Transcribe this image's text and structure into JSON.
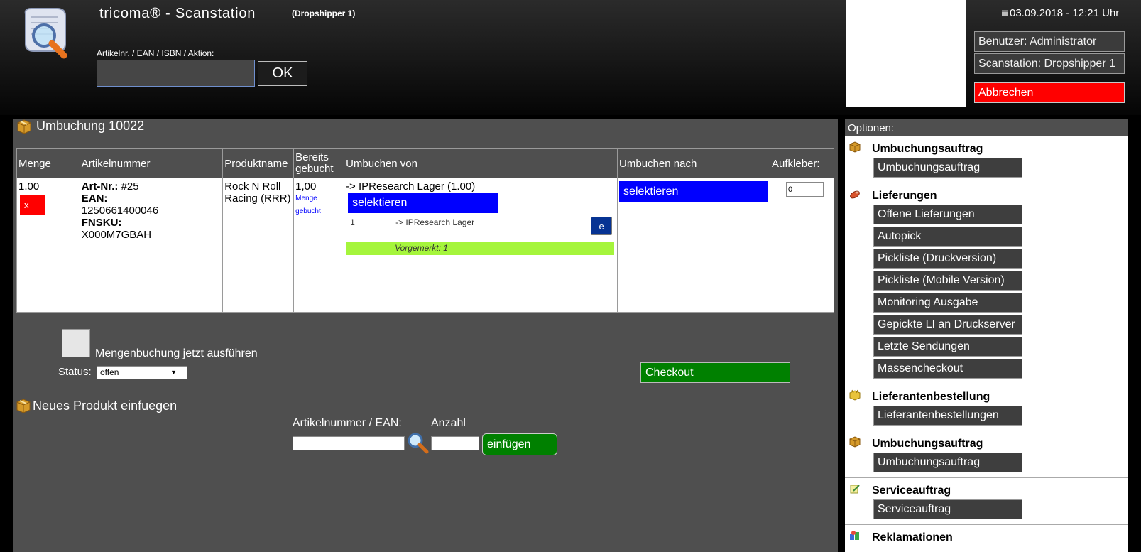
{
  "header": {
    "title": "tricoma® - Scanstation",
    "subtitle": "(Dropshipper 1)",
    "scan_label": "Artikelnr. / EAN / ISBN / Aktion:",
    "scan_value": "",
    "ok_label": "OK",
    "datetime": "03.09.2018 - 12:21 Uhr",
    "user": "Benutzer: Administrator",
    "station": "Scanstation: Dropshipper 1",
    "cancel_label": "Abbrechen"
  },
  "booking": {
    "title": "Umbuchung 10022",
    "columns": {
      "qty": "Menge",
      "article": "Artikelnummer",
      "product": "Produktname",
      "booked_1": "Bereits",
      "booked_2": "gebucht",
      "from": "Umbuchen von",
      "to": "Umbuchen nach",
      "sticker": "Aufkleber:"
    },
    "row": {
      "qty": "1.00",
      "delete_label": "x",
      "art_nr_label": "Art-Nr.:",
      "art_nr": "#25",
      "ean_label": "EAN:",
      "ean": "1250661400046",
      "fnsku_label": "FNSKU:",
      "fnsku": "X000M7GBAH",
      "product_name": "Rock N Roll Racing (RRR)",
      "booked_value": "1,00",
      "booked_note_1": "Menge",
      "booked_note_2": "gebucht",
      "from_location": "-> IPResearch Lager (1.00)",
      "select_from_label": "selektieren",
      "source_qty": "1",
      "source_location": "-> IPResearch Lager",
      "edit_label": "e",
      "reserved": "Vorgemerkt: 1",
      "select_to_label": "selektieren",
      "sticker_value": "0"
    },
    "booking_now_label": "Mengenbuchung jetzt ausführen",
    "status_label": "Status:",
    "status_value": "offen",
    "checkout_label": "Checkout"
  },
  "new_product": {
    "title": "Neues Produkt einfuegen",
    "article_label": "Artikelnummer / EAN:",
    "qty_label": "Anzahl",
    "insert_label": "einfügen"
  },
  "options": {
    "header": "Optionen:",
    "sections": [
      {
        "title": "Umbuchungsauftrag",
        "items": [
          "Umbuchungsauftrag"
        ]
      },
      {
        "title": "Lieferungen",
        "items": [
          "Offene Lieferungen",
          "Autopick",
          "Pickliste (Druckversion)",
          "Pickliste (Mobile Version)",
          "Monitoring Ausgabe",
          "Gepickte LI an Druckserver",
          "Letzte Sendungen",
          "Massencheckout"
        ]
      },
      {
        "title": "Lieferantenbestellung",
        "items": [
          "Lieferantenbestellungen"
        ]
      },
      {
        "title": "Umbuchungsauftrag",
        "items": [
          "Umbuchungsauftrag"
        ]
      },
      {
        "title": "Serviceauftrag",
        "items": [
          "Serviceauftrag"
        ]
      },
      {
        "title": "Reklamationen",
        "items": []
      }
    ]
  }
}
